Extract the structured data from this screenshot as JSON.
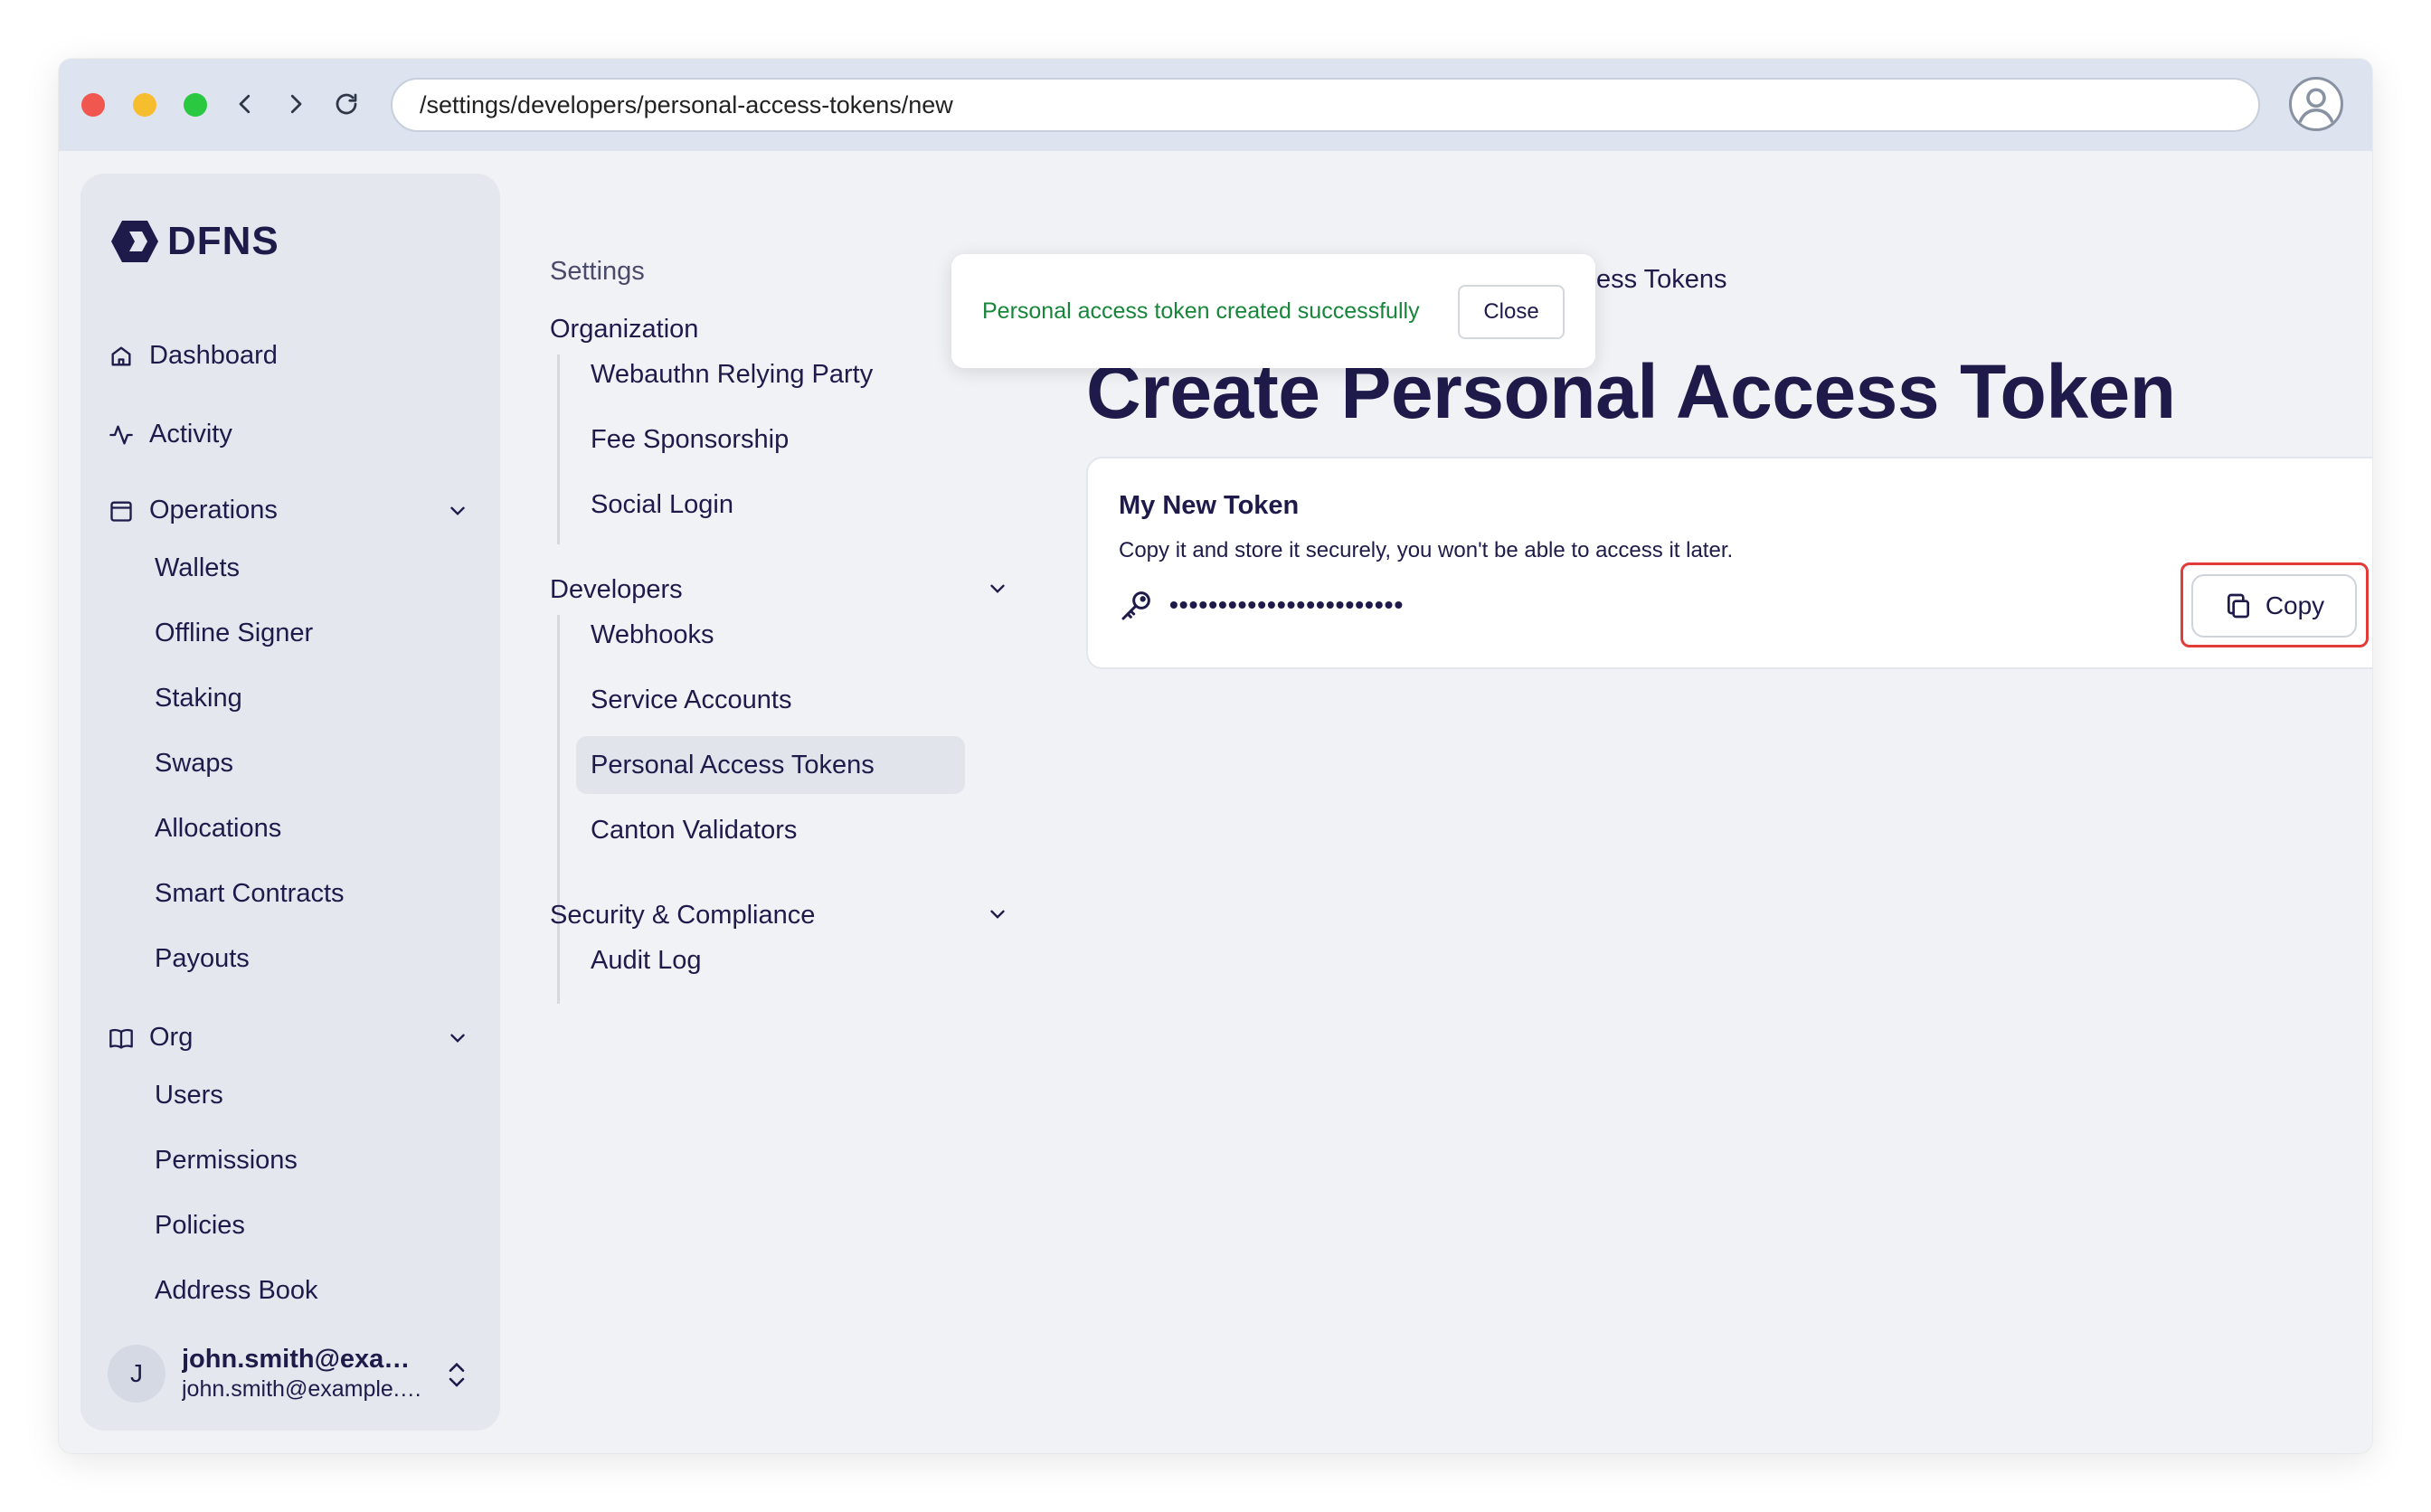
{
  "browser": {
    "url": "/settings/developers/personal-access-tokens/new"
  },
  "brand": {
    "name": "DFNS"
  },
  "sidebar": {
    "dashboard": "Dashboard",
    "activity": "Activity",
    "operations": {
      "label": "Operations",
      "items": [
        "Wallets",
        "Offline Signer",
        "Staking",
        "Swaps",
        "Allocations",
        "Smart Contracts",
        "Payouts"
      ]
    },
    "org": {
      "label": "Org",
      "items": [
        "Users",
        "Permissions",
        "Policies",
        "Address Book"
      ]
    },
    "user": {
      "initial": "J",
      "name": "john.smith@exam...",
      "email": "john.smith@example.c..."
    }
  },
  "settings_nav": {
    "heading": "Settings",
    "organization": {
      "label": "Organization",
      "items": [
        "Webauthn Relying Party",
        "Fee Sponsorship",
        "Social Login"
      ]
    },
    "developers": {
      "label": "Developers",
      "items": [
        "Webhooks",
        "Service Accounts",
        "Personal Access Tokens",
        "Canton Validators"
      ],
      "active": "Personal Access Tokens"
    },
    "security": {
      "label": "Security & Compliance",
      "items": [
        "Audit Log"
      ]
    }
  },
  "toast": {
    "message": "Personal access token created successfully",
    "close_label": "Close"
  },
  "main": {
    "breadcrumb_tail": "ess Tokens",
    "title": "Create Personal Access Token",
    "card": {
      "title": "My New Token",
      "description": "Copy it and store it securely, you won't be able to access it later.",
      "token_masked": "••••••••••••••••••••••••",
      "copy_label": "Copy"
    }
  },
  "colors": {
    "primary_text": "#1e1b4b",
    "success": "#17863a",
    "highlight": "#e33a3a"
  }
}
